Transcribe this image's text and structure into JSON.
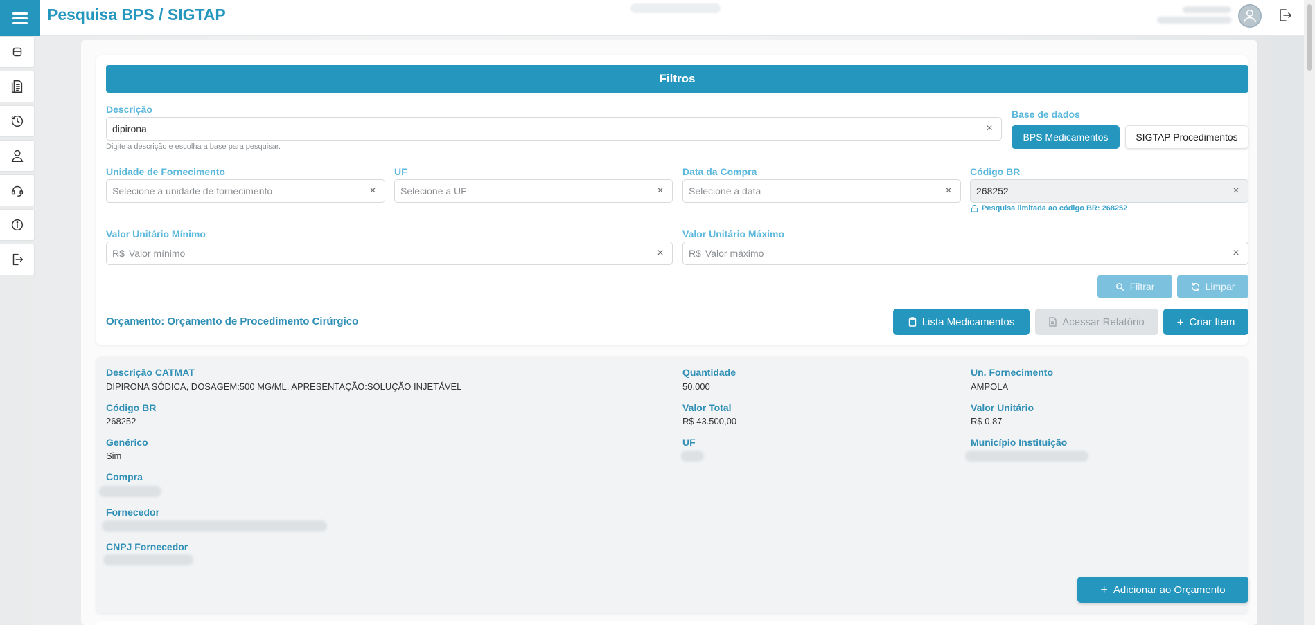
{
  "app": {
    "title": "Pesquisa BPS / SIGTAP"
  },
  "sidenav": {
    "items": [
      {
        "icon": "dashboard-icon"
      },
      {
        "icon": "document-icon"
      },
      {
        "icon": "history-icon"
      },
      {
        "icon": "user-icon"
      },
      {
        "icon": "headset-icon"
      },
      {
        "icon": "info-icon"
      },
      {
        "icon": "logout-icon"
      }
    ]
  },
  "filters": {
    "header": "Filtros",
    "descricao": {
      "label": "Descrição",
      "value": "dipirona",
      "hint": "Digite a descrição e escolha a base para pesquisar."
    },
    "base_dados": {
      "label": "Base de dados",
      "options": [
        "BPS Medicamentos",
        "SIGTAP Procedimentos"
      ],
      "selected": "BPS Medicamentos"
    },
    "unidade": {
      "label": "Unidade de Fornecimento",
      "placeholder": "Selecione a unidade de fornecimento"
    },
    "uf": {
      "label": "UF",
      "placeholder": "Selecione a UF"
    },
    "data_compra": {
      "label": "Data da Compra",
      "placeholder": "Selecione a data"
    },
    "codigo_br": {
      "label": "Código BR",
      "value": "268252",
      "lock_hint": "Pesquisa limitada ao código BR: 268252"
    },
    "valor_min": {
      "label": "Valor Unitário Mínimo",
      "prefix": "R$",
      "placeholder": "Valor mínimo"
    },
    "valor_max": {
      "label": "Valor Unitário Máximo",
      "prefix": "R$",
      "placeholder": "Valor máximo"
    },
    "filtrar_label": "Filtrar",
    "limpar_label": "Limpar"
  },
  "orcamento": {
    "title": "Orçamento: Orçamento de Procedimento Cirúrgico",
    "lista_label": "Lista Medicamentos",
    "relatorio_label": "Acessar Relatório",
    "criar_label": "Criar Item"
  },
  "result": {
    "descricao_catmat": {
      "label": "Descrição CATMAT",
      "value": "DIPIRONA SÓDICA, DOSAGEM:500 MG/ML, APRESENTAÇÃO:SOLUÇÃO INJETÁVEL"
    },
    "quantidade": {
      "label": "Quantidade",
      "value": "50.000"
    },
    "un_fornecimento": {
      "label": "Un. Fornecimento",
      "value": "AMPOLA"
    },
    "codigo_br": {
      "label": "Código BR",
      "value": "268252"
    },
    "valor_total": {
      "label": "Valor Total",
      "value": "R$ 43.500,00"
    },
    "valor_unitario": {
      "label": "Valor Unitário",
      "value": "R$ 0,87"
    },
    "generico": {
      "label": "Genérico",
      "value": "Sim"
    },
    "uf": {
      "label": "UF"
    },
    "municipio": {
      "label": "Município Instituição"
    },
    "compra": {
      "label": "Compra"
    },
    "fornecedor": {
      "label": "Fornecedor"
    },
    "cnpj": {
      "label": "CNPJ Fornecedor"
    },
    "adicionar_label": "Adicionar ao Orçamento"
  },
  "colors": {
    "primary": "#2596be",
    "label_light": "#5bb8dc",
    "label_dark": "#2f8fb5"
  }
}
